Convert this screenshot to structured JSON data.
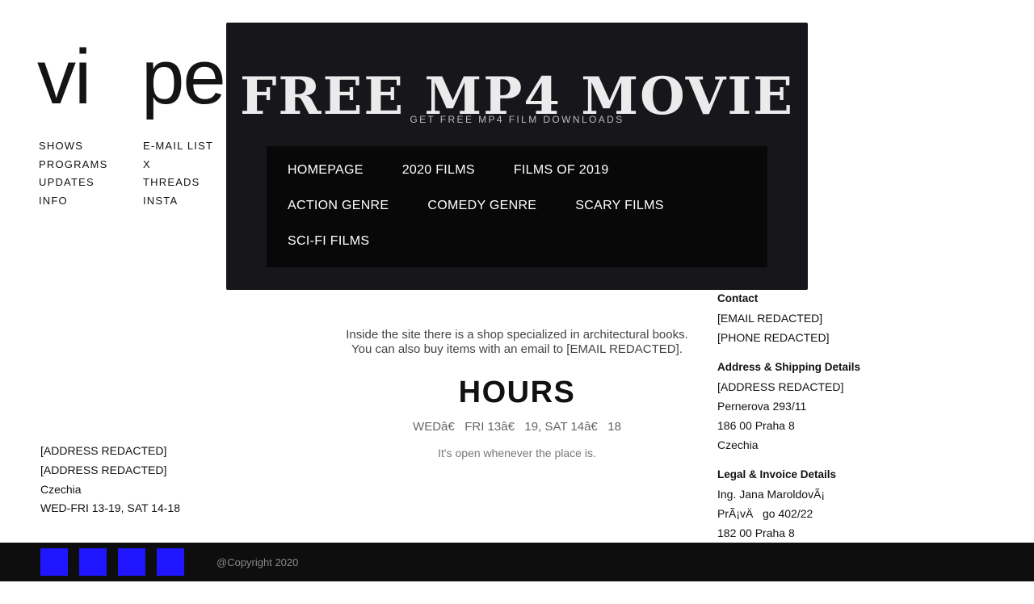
{
  "brand": {
    "left": "vi",
    "right": "per"
  },
  "nav": {
    "col1": [
      "SHOWS",
      "PROGRAMS",
      "UPDATES",
      "INFO"
    ],
    "col2": [
      "E-MAIL LIST",
      "X",
      "THREADS",
      "INSTA"
    ]
  },
  "overlay": {
    "title": "FREE MP4 MOVIE",
    "subtitle": "GET FREE MP4 FILM DOWNLOADS",
    "menu": {
      "row1": [
        "HOMEPAGE",
        "2020 FILMS",
        "FILMS OF 2019"
      ],
      "row2": [
        "ACTION GENRE",
        "COMEDY GENRE",
        "SCARY FILMS"
      ],
      "row3": [
        "SCI-FI FILMS"
      ]
    }
  },
  "main": {
    "intro_line1": "Inside the site there is a shop specialized in architectural books.",
    "intro_line2": "You can also buy items with an email to [EMAIL REDACTED].",
    "hours_title": "HOURS",
    "hours_text": "WEDâ€   FRI 13â€   19, SAT 14â€   18",
    "open_text": "It's open whenever the place is."
  },
  "address_left": [
    "[ADDRESS REDACTED]",
    "[ADDRESS REDACTED]",
    "Czechia",
    "WED-FRI 13-19, SAT 14-18"
  ],
  "right": {
    "contact_title": "Contact",
    "contact": [
      "[EMAIL REDACTED]",
      "[PHONE REDACTED]"
    ],
    "shipping_title": "Address & Shipping Details",
    "shipping": [
      "[ADDRESS REDACTED]",
      "Pernerova 293/11",
      "186 00 Praha 8",
      "Czechia"
    ],
    "legal_title": "Legal & Invoice Details",
    "legal": [
      "Ing. Jana MaroldovÃ¡",
      "PrÃ¡vÄ   go 402/22",
      "182 00 Praha 8"
    ]
  },
  "footer": {
    "social_icons": [
      "social-icon-1",
      "social-icon-2",
      "social-icon-3",
      "social-icon-4"
    ],
    "social_color": "#1f16ff",
    "copyright": "@Copyright 2020"
  }
}
